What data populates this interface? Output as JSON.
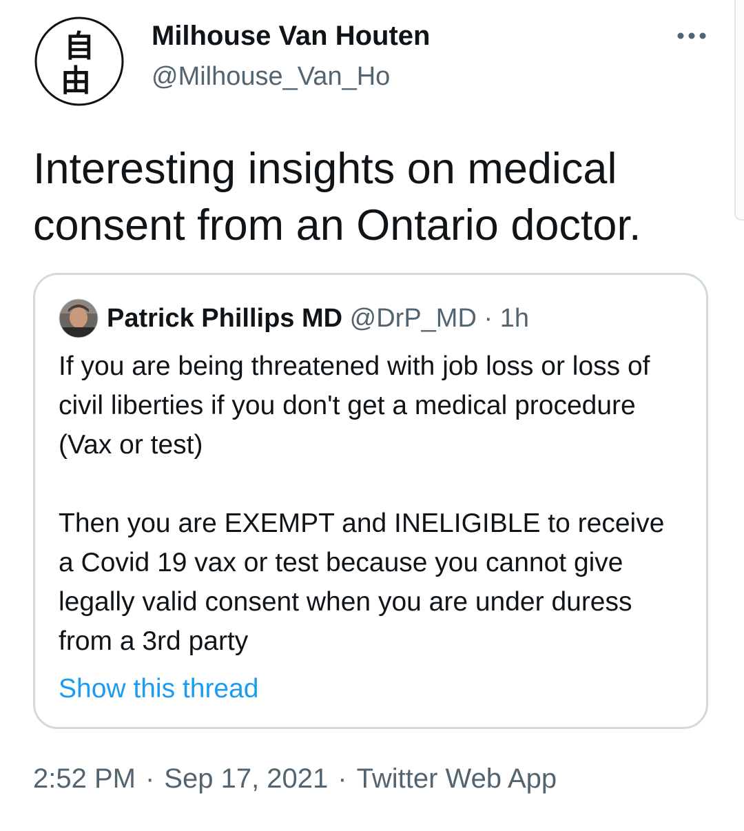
{
  "tweet": {
    "author": {
      "name": "Milhouse Van Houten",
      "handle": "@Milhouse_Van_Ho",
      "avatar_glyphs": [
        "自",
        "由"
      ]
    },
    "text": "Interesting insights on medical consent from an Ontario doctor.",
    "more_icon": "ellipsis-icon",
    "quoted": {
      "name": "Patrick Phillips MD",
      "handle": "@DrP_MD",
      "separator": "·",
      "time": "1h",
      "paragraphs": [
        "If you are being threatened with job loss or loss of civil liberties if you don't get a medical procedure (Vax or test)",
        "Then you are EXEMPT and INELIGIBLE to receive a Covid 19 vax or test because you cannot give legally valid consent when you are under duress from a 3rd party"
      ],
      "show_thread": "Show this thread"
    },
    "footer": {
      "time": "2:52 PM",
      "date": "Sep 17, 2021",
      "source": "Twitter Web App",
      "separator": "·"
    }
  },
  "colors": {
    "text": "#0f1419",
    "muted": "#536471",
    "link": "#1d9bf0",
    "border": "#cfd9de"
  }
}
